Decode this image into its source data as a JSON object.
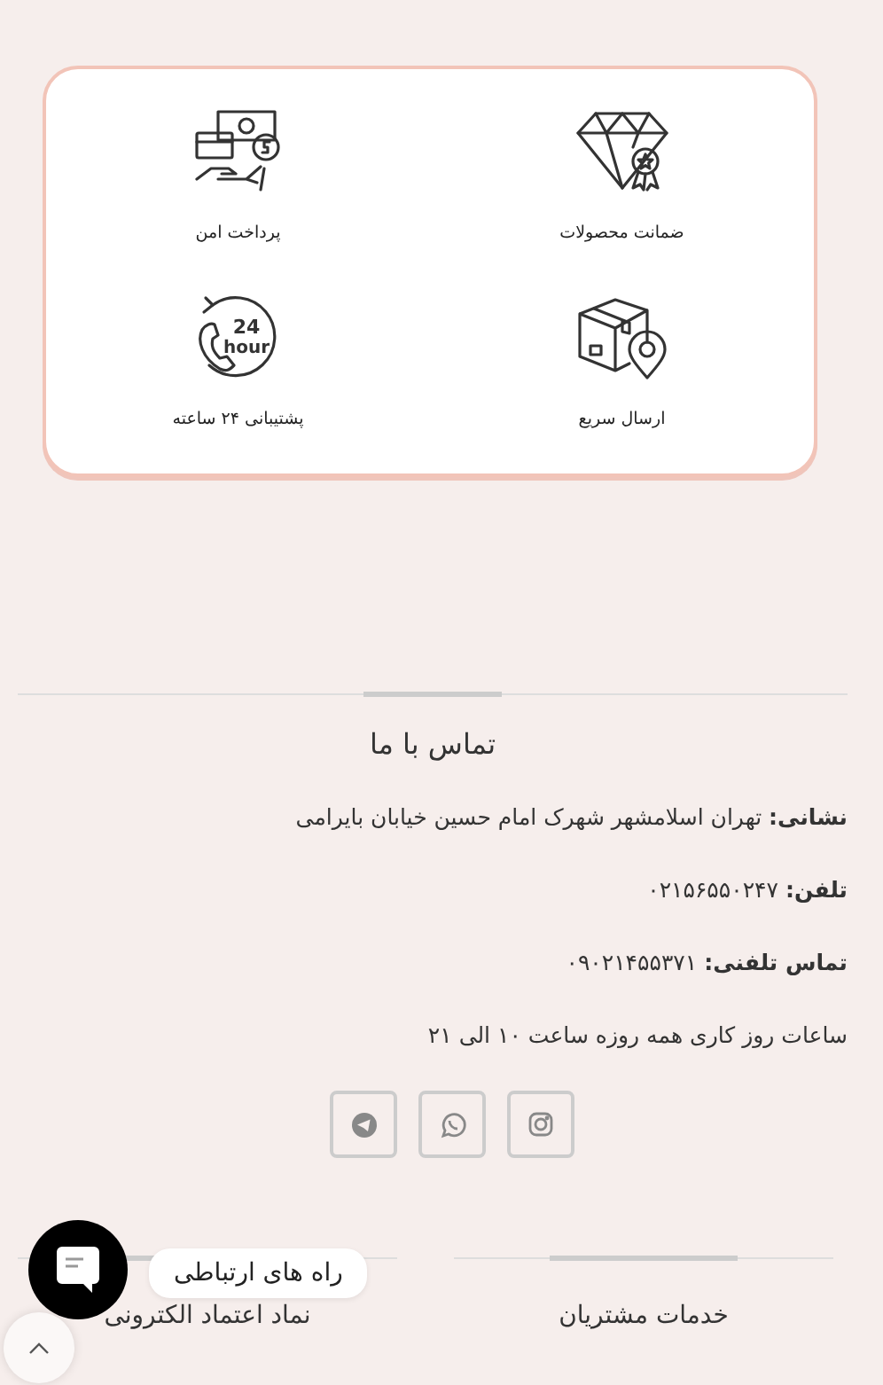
{
  "features": [
    {
      "kind": "diamond",
      "label": "ضمانت محصولات"
    },
    {
      "kind": "delivery",
      "label": "ارسال سریع"
    },
    {
      "kind": "payment",
      "label": "پرداخت امن"
    },
    {
      "kind": "support",
      "label": "پشتیبانی ۲۴ ساعته",
      "icon_text": [
        "24",
        "hour"
      ]
    }
  ],
  "contact": {
    "title": "تماس با ما",
    "lines": [
      "**نشانی:** تهران اسلامشهر شهرک امام حسین خیابان بایرامی",
      "**تلفن:** ۰۲۱۵۶۵۵۰۲۴۷",
      "**تماس تلفنی:** ۰۹۰۲۱۴۵۵۳۷۱",
      "ساعات روز کاری همه روزه ساعت ۱۰ الی ۲۱"
    ],
    "socials": [
      {
        "kind": "instagram"
      },
      {
        "kind": "whatsapp"
      },
      {
        "kind": "telegram"
      }
    ]
  },
  "footer_columns": [
    {
      "title": "خدمات مشتریان"
    },
    {
      "title": "نماد اعتماد الکترونی"
    }
  ],
  "chat": {
    "tooltip": "راه های ارتباطی"
  }
}
